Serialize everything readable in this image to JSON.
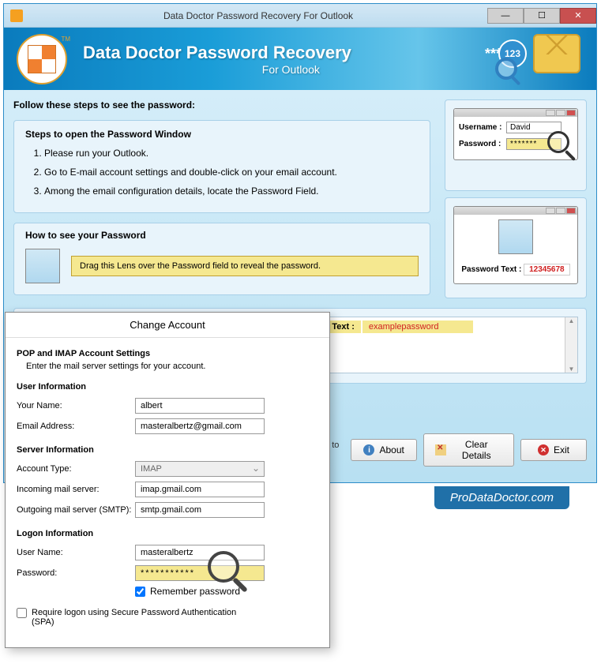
{
  "titlebar": {
    "title": "Data Doctor Password Recovery For Outlook"
  },
  "header": {
    "title": "Data Doctor Password Recovery",
    "subtitle": "For Outlook",
    "badge": "123"
  },
  "instructions": {
    "follow": "Follow these steps to see the password:",
    "steps_title": "Steps to open the Password Window",
    "steps": [
      "Please run your Outlook.",
      "Go to E-mail account settings and double-click on your email account.",
      "Among the email configuration details, locate the Password Field."
    ],
    "howto_title": "How to see your Password",
    "drag": "Drag this Lens over the Password field to reveal the password."
  },
  "illus1": {
    "username_label": "Username :",
    "username_val": "David",
    "password_label": "Password  :",
    "password_val": "*******"
  },
  "illus2": {
    "label": "Password Text :",
    "value": "12345678"
  },
  "result": {
    "label": "word Text :",
    "value": "examplepassword"
  },
  "buttons": {
    "mailk": "Mail to k",
    "about": "About",
    "clear": "Clear Details",
    "exit": "Exit"
  },
  "footer": {
    "url": "ProDataDoctor.com"
  },
  "dialog": {
    "title": "Change Account",
    "heading": "POP and IMAP Account Settings",
    "sub": "Enter the mail server settings for your account.",
    "sections": {
      "user": "User Information",
      "server": "Server Information",
      "logon": "Logon Information"
    },
    "labels": {
      "name": "Your Name:",
      "email": "Email Address:",
      "acct_type": "Account Type:",
      "incoming": "Incoming mail server:",
      "outgoing": "Outgoing mail server (SMTP):",
      "username": "User Name:",
      "password": "Password:",
      "remember": "Remember password",
      "spa": "Require logon using Secure Password Authentication (SPA)"
    },
    "values": {
      "name": "albert",
      "email": "masteralbertz@gmail.com",
      "acct_type": "IMAP",
      "incoming": "imap.gmail.com",
      "outgoing": "smtp.gmail.com",
      "username": "masteralbertz",
      "password": "***********"
    }
  }
}
